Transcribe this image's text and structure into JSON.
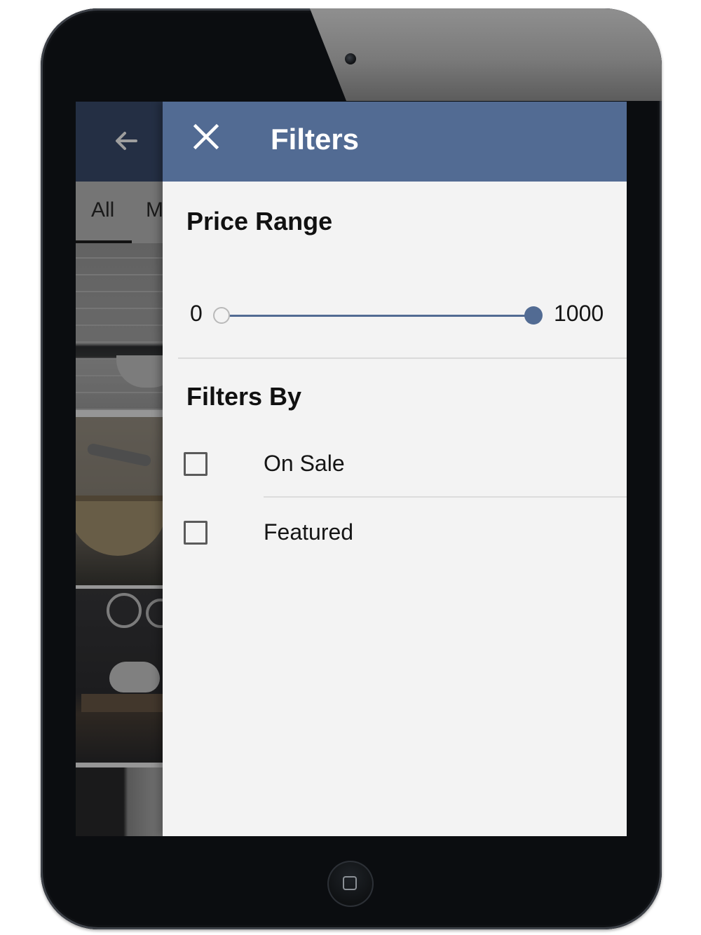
{
  "background_app": {
    "tabs": [
      "All",
      "M"
    ],
    "selected_tab": "All",
    "back_icon": "arrow-left-icon"
  },
  "filters_panel": {
    "title": "Filters",
    "close_icon": "close-icon",
    "price_range": {
      "title": "Price Range",
      "min_label": "0",
      "max_label": "1000",
      "selected_min": 0,
      "selected_max": 1000
    },
    "filters_by": {
      "title": "Filters By",
      "options": [
        {
          "label": "On Sale",
          "checked": false
        },
        {
          "label": "Featured",
          "checked": false
        }
      ]
    }
  },
  "colors": {
    "header": "#526b93",
    "background_header": "#3a4d6f",
    "panel_background": "#f3f3f3",
    "slider_accent": "#526b93"
  }
}
